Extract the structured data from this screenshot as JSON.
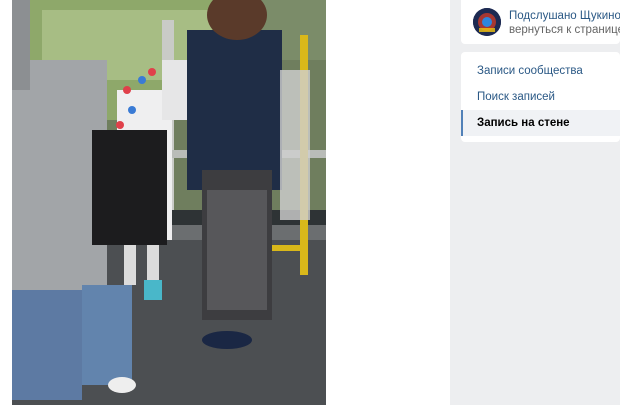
{
  "post": {
    "photo_icon": "photo-bus-pony"
  },
  "group": {
    "title": "Подслушано Щукино",
    "back_link": "вернуться к странице",
    "avatar_icon": "group-avatar"
  },
  "menu": {
    "items": [
      {
        "label": "Записи сообщества",
        "active": false
      },
      {
        "label": "Поиск записей",
        "active": false
      },
      {
        "label": "Запись на стене",
        "active": true
      }
    ]
  },
  "colors": {
    "link": "#2a5885",
    "accent": "#5181b8",
    "page_bg": "#edeef0"
  }
}
